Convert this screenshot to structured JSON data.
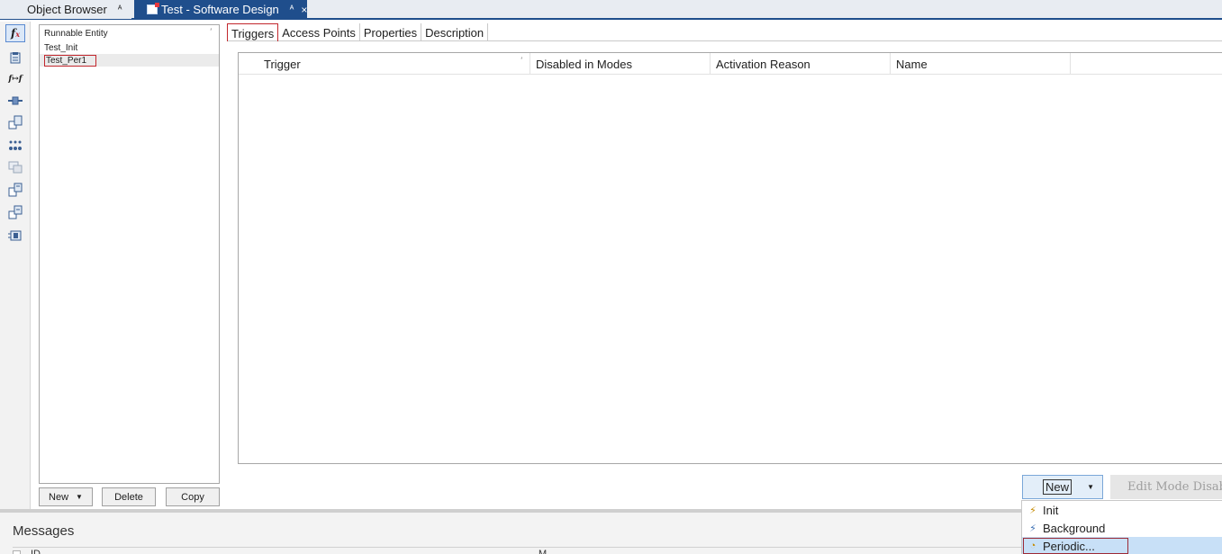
{
  "document_tabs": [
    {
      "label": "Object Browser",
      "pin": "ᴬ"
    },
    {
      "label": "Test - Software Design",
      "pin": "ᴬ",
      "close": "×"
    }
  ],
  "toolbar": {
    "icons": [
      "function-icon",
      "clipboard-icon",
      "function-chain-icon",
      "port-icon",
      "component-add-icon",
      "variables-icon",
      "cluster-icon",
      "runnable-icon",
      "mapping-icon",
      "module-icon"
    ]
  },
  "runnables": {
    "header": "Runnable Entity",
    "sort_glyph": "′",
    "items": [
      "Test_Init",
      "Test_Per1"
    ],
    "selected": "Test_Per1",
    "buttons": {
      "new": "New",
      "delete": "Delete",
      "copy": "Copy"
    }
  },
  "main": {
    "tabs": [
      "Triggers",
      "Access Points",
      "Properties",
      "Description"
    ],
    "active_tab": "Triggers",
    "columns": [
      "Trigger",
      "Disabled in Modes",
      "Activation Reason",
      "Name"
    ],
    "sort_glyph": "′",
    "new_button": "New",
    "edit_button": "Edit Mode Disabli",
    "new_menu": [
      {
        "label": "Init",
        "icon": "init-icon"
      },
      {
        "label": "Background",
        "icon": "background-icon"
      },
      {
        "label": "Periodic...",
        "icon": "periodic-icon"
      }
    ]
  },
  "messages": {
    "title": "Messages",
    "columns": [
      "ID",
      "M"
    ]
  },
  "colors": {
    "accent": "#1f4e8c",
    "highlight_border": "#c2272d",
    "menu_hover": "#c8e0f7"
  }
}
